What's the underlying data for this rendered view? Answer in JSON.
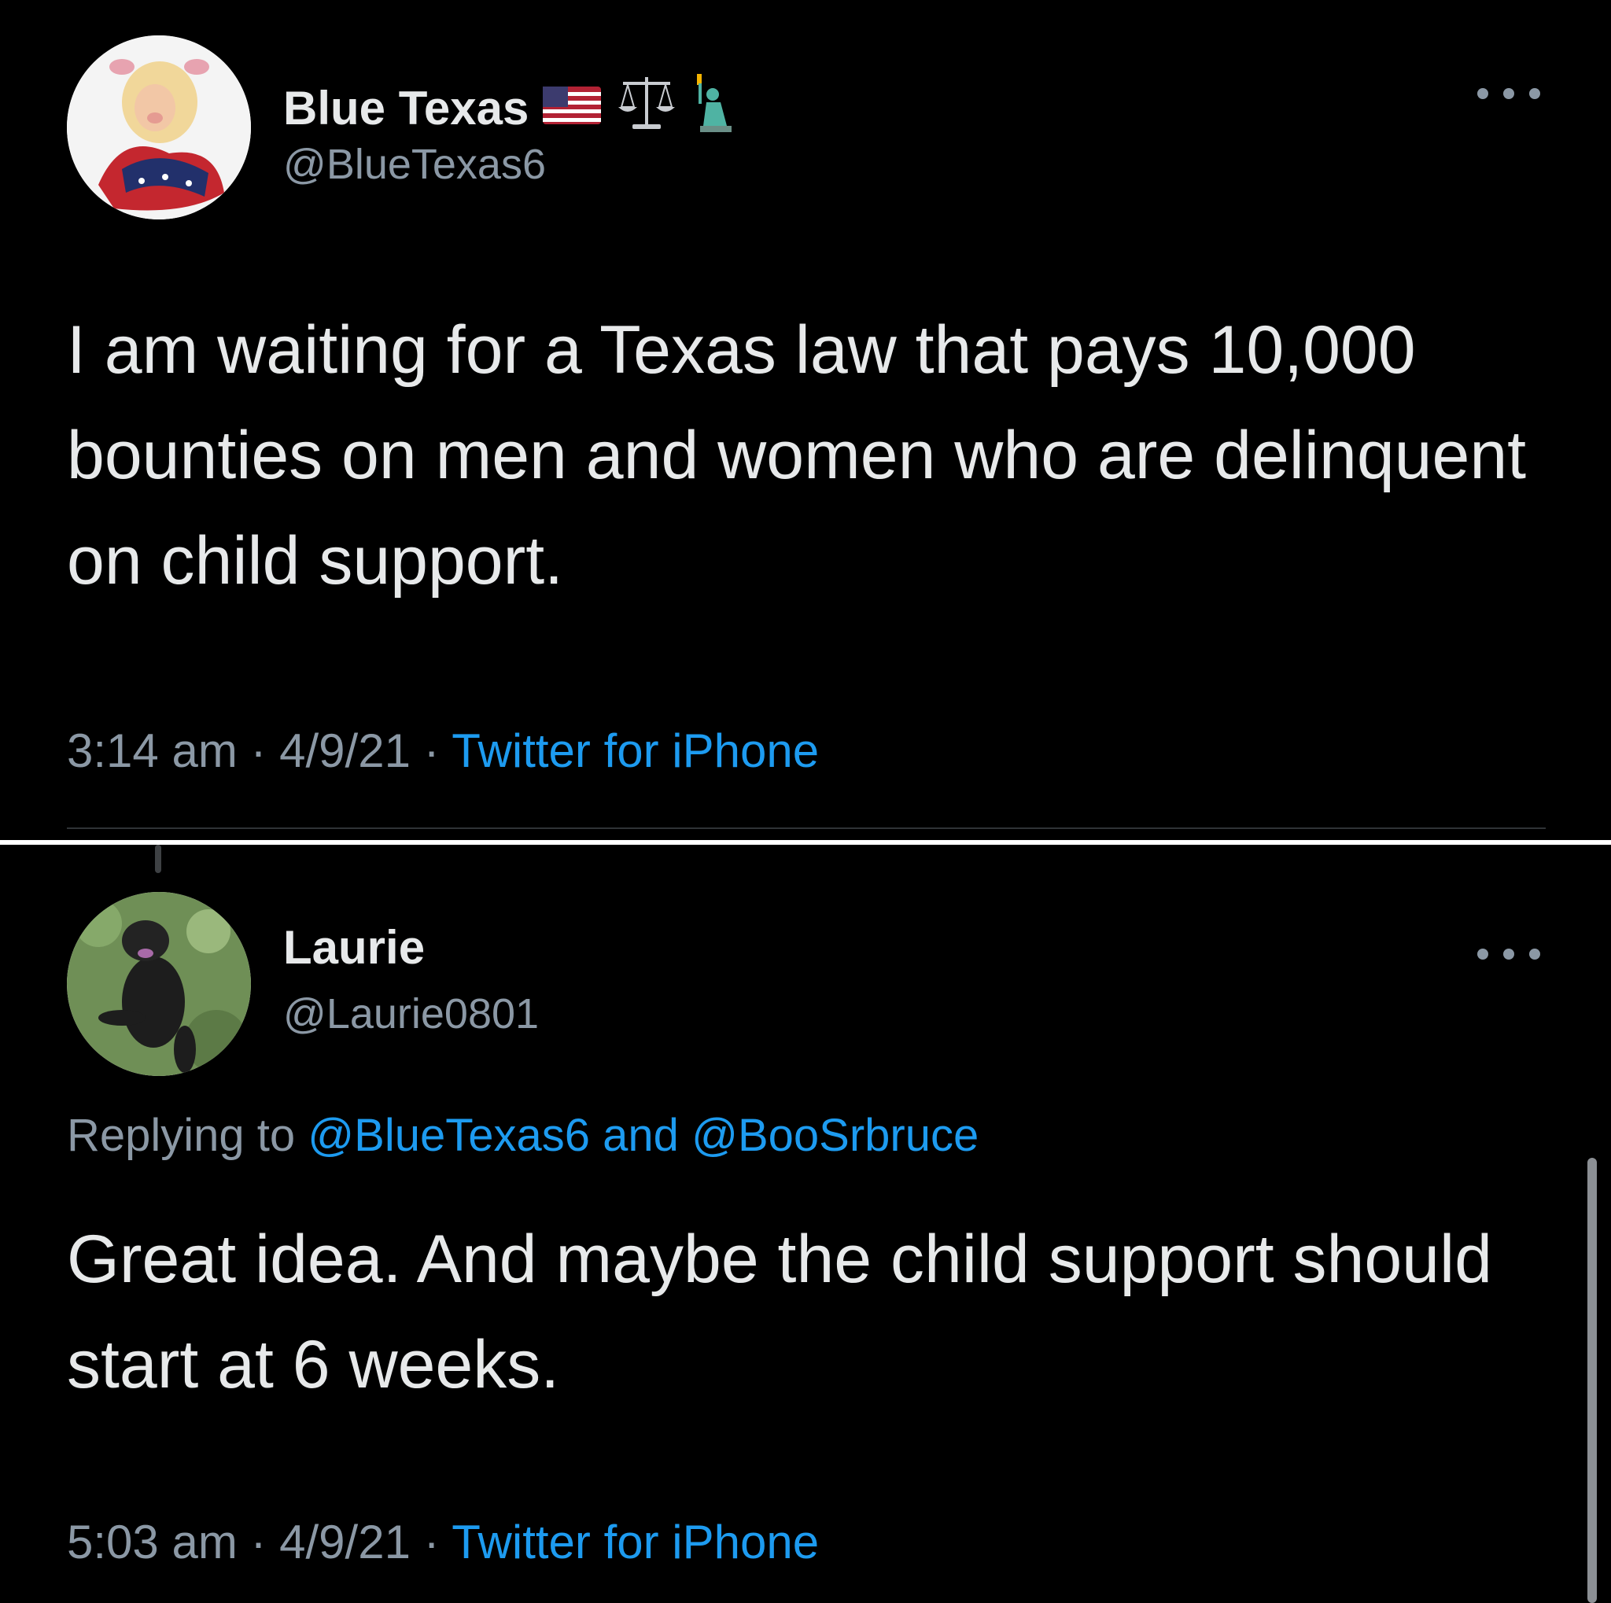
{
  "tweets": [
    {
      "name": "Blue Texas",
      "handle": "@BlueTexas6",
      "text": "I am waiting for a Texas law that pays 10,000 bounties on men and women who are delinquent on child support.",
      "time": "3:14 am",
      "date": "4/9/21",
      "source": "Twitter for iPhone",
      "name_emojis": [
        "flag-usa-icon",
        "scales-icon",
        "statue-of-liberty-icon"
      ]
    },
    {
      "name": "Laurie",
      "handle": "@Laurie0801",
      "replying_prefix": "Replying to",
      "reply_mention_1": "@BlueTexas6",
      "reply_and": "and",
      "reply_mention_2": "@BooSrbruce",
      "text": "Great idea. And maybe the child support should start at 6 weeks.",
      "time": "5:03 am",
      "date": "4/9/21",
      "source": "Twitter for iPhone"
    }
  ],
  "separator": "·",
  "colors": {
    "background": "#000000",
    "text": "#e7e9ea",
    "secondary": "#8b98a5",
    "link": "#1d9bf0"
  }
}
